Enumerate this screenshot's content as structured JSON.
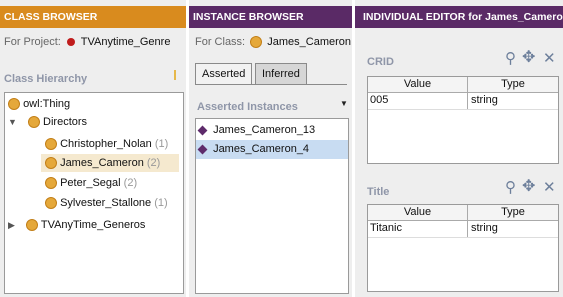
{
  "class_browser": {
    "header": "CLASS BROWSER",
    "project_label": "For Project:",
    "project_name": "TVAnytime_Genre",
    "hierarchy_title": "Class Hierarchy",
    "tree": [
      {
        "label": "owl:Thing",
        "count": ""
      },
      {
        "label": "Directors",
        "count": ""
      },
      {
        "label": "Christopher_Nolan",
        "count": "(1)"
      },
      {
        "label": "James_Cameron",
        "count": "(2)"
      },
      {
        "label": "Peter_Segal",
        "count": "(2)"
      },
      {
        "label": "Sylvester_Stallone",
        "count": "(1)"
      },
      {
        "label": "TVAnyTime_Generos",
        "count": ""
      }
    ]
  },
  "instance_browser": {
    "header": "INSTANCE BROWSER",
    "class_label": "For Class:",
    "class_name": "James_Cameron",
    "tabs": [
      "Asserted",
      "Inferred"
    ],
    "list_title": "Asserted Instances",
    "instances": [
      "James_Cameron_13",
      "James_Cameron_4"
    ]
  },
  "individual_editor": {
    "header": "INDIVIDUAL EDITOR for James_Cameron",
    "sections": [
      {
        "title": "CRID",
        "columns": [
          "Value",
          "Type"
        ],
        "rows": [
          {
            "value": "005",
            "type": "string"
          }
        ]
      },
      {
        "title": "Title",
        "columns": [
          "Value",
          "Type"
        ],
        "rows": [
          {
            "value": "Titanic",
            "type": "string"
          }
        ]
      }
    ]
  },
  "colors": {
    "header_class": "#d98b1e",
    "header_instance": "#5a2a66",
    "selection": "#c8dcf2"
  }
}
